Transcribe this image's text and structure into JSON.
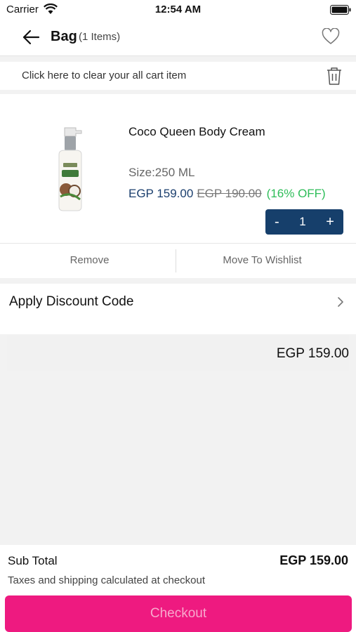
{
  "status_bar": {
    "carrier": "Carrier",
    "time": "12:54 AM"
  },
  "header": {
    "title": "Bag",
    "item_count": "(1 Items)"
  },
  "clear_cart": {
    "text": "Click here to clear your all cart item"
  },
  "product": {
    "name": "Coco Queen Body Cream",
    "size": "Size:250 ML",
    "price": "EGP 159.00",
    "old_price": "EGP 190.00",
    "discount": "(16% OFF)",
    "quantity": "1",
    "minus": "-",
    "plus": "+"
  },
  "actions": {
    "remove": "Remove",
    "move_to_wishlist": "Move To Wishlist"
  },
  "discount_code": {
    "label": "Apply Discount Code"
  },
  "order": {
    "total": "EGP 159.00"
  },
  "footer": {
    "subtotal_label": "Sub Total",
    "subtotal_value": "EGP 159.00",
    "tax_note": "Taxes and shipping calculated at checkout",
    "checkout_label": "Checkout"
  },
  "colors": {
    "accent": "#ee1a80",
    "stepper": "#163f6b",
    "discount": "#2ebd59",
    "price": "#1b3f6e"
  }
}
